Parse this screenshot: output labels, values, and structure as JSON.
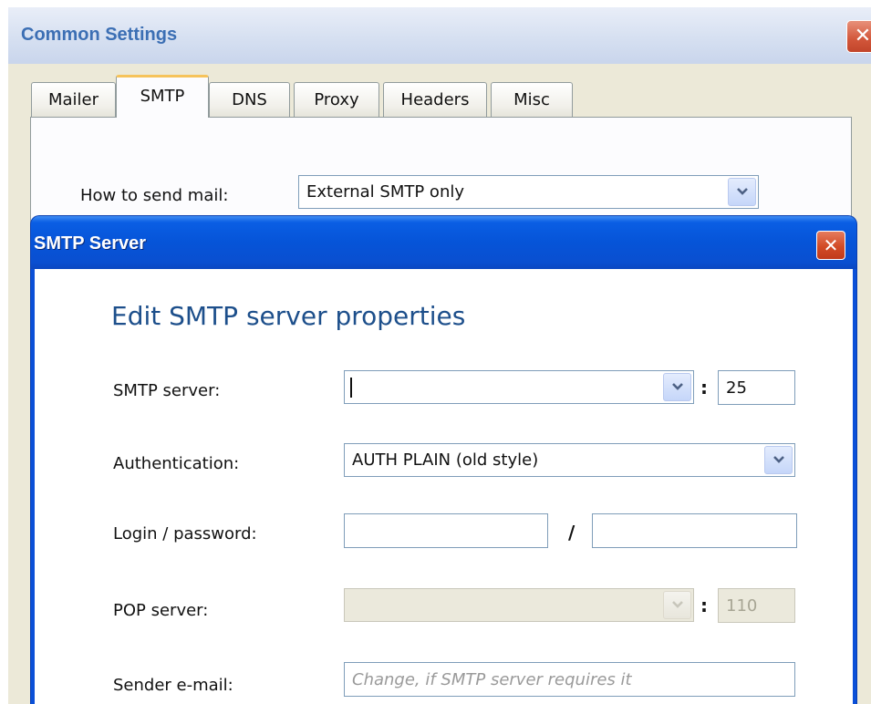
{
  "outer": {
    "title": "Common Settings",
    "close_glyph": "✕",
    "tabs": [
      "Mailer",
      "SMTP",
      "DNS",
      "Proxy",
      "Headers",
      "Misc"
    ],
    "active_tab": "SMTP",
    "how_label": "How to send mail:",
    "how_value": "External SMTP only"
  },
  "dialog": {
    "title": "SMTP Server",
    "close_glyph": "✕",
    "heading": "Edit SMTP server properties",
    "smtp_server_label": "SMTP server:",
    "smtp_server_value": "",
    "smtp_port_sep": ":",
    "smtp_port": "25",
    "auth_label": "Authentication:",
    "auth_value": "AUTH PLAIN (old style)",
    "login_label": "Login / password:",
    "login_value": "",
    "login_sep": "/",
    "password_value": "",
    "pop_label": "POP server:",
    "pop_value": "",
    "pop_port_sep": ":",
    "pop_port": "110",
    "sender_label": "Sender e-mail:",
    "sender_placeholder": "Change, if SMTP server requires it"
  },
  "colors": {
    "dialog_title_bg": "#0654d8",
    "heading": "#1d4f8b",
    "close_button": "#d24b26",
    "active_tab_accent": "#f6c35b"
  },
  "icons": [
    "close-icon",
    "chevron-down-icon"
  ]
}
